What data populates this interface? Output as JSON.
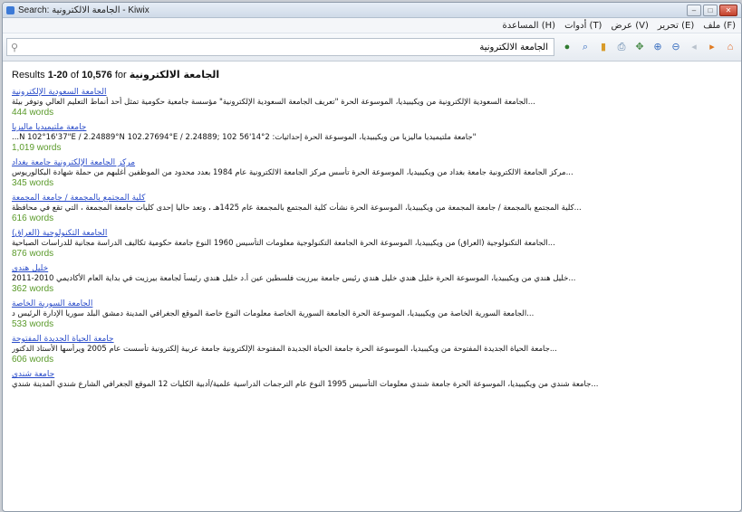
{
  "window": {
    "title": "Search: الجامعة الالكترونية - Kiwix"
  },
  "menu": [
    "المساعدة (H)",
    "أدوات (T)",
    "عرض (V)",
    "تحرير (E)",
    "ملف (F)"
  ],
  "search": {
    "value": "الجامعة الالكترونية",
    "placeholder": ""
  },
  "results": {
    "prefix": "Results",
    "range": "1-20",
    "of": "of",
    "total": "10,576",
    "for": "for",
    "query": "الجامعة الالكترونية"
  },
  "items": [
    {
      "title": "الجامعة السعودية الإلكترونية",
      "snippet": "...الجامعة السعودية الإلكترونية من ويكيبيديا، الموسوعة الحرة \"تعريف الجامعة السعودية الإلكترونية\" مؤسسة جامعية حكومية تمثل أحد أنماط التعليم العالي وتوفر بيئة",
      "words": "444 words"
    },
    {
      "title": "جامعة ملتيميديا ماليزيا",
      "snippet": "...N 102°16'37\"E / 2.24889°N 102.27694°E / 2.24889; 102 جامعة ملتيميديا ماليزيا من ويكيبيديا، الموسوعة الحرة إحداثيات: 2°14'56\"",
      "words": "1,019 words"
    },
    {
      "title": "مركز الجامعة الإلكترونية جامعة بغداد",
      "snippet": "...مركز الجامعة الالكترونية جامعة بغداد من ويكيبيديا، الموسوعة الحرة تأسس مركز الجامعة الالكترونية عام 1984 بعدد محدود من الموظفين أغلبهم من حملة شهادة البكالوريوس",
      "words": "345 words"
    },
    {
      "title": "كلية المجتمع بالمجمعة / جامعة المجمعة",
      "snippet": "...كلية المجتمع بالمجمعة / جامعة المجمعة من ويكيبيديا، الموسوعة الحرة نشأت كلية المجتمع بالمجمعة عام 1425هـ ، وتعد حاليا إحدى كليات جامعة المجمعة ، التي تقع في محافظة",
      "words": "616 words"
    },
    {
      "title": "الجامعة التكنولوجية (العراق)",
      "snippet": "...الجامعة التكنولوجية (العراق) من ويكيبيديا، الموسوعة الحرة الجامعة التكنولوجية معلومات التأسيس 1960 النوع جامعة حكومية تكاليف الدراسة مجانية للدراسات الصباحية",
      "words": "876 words"
    },
    {
      "title": "خليل هندي",
      "snippet": "...خليل هندي من ويكيبيديا، الموسوعة الحرة خليل هندي خليل هندي رئيس جامعة بيرزيت فلسطين عين أ.د خليل هندي رئيساً لجامعة بيرزيت في بداية العام الأكاديمي 2010-2011",
      "words": "362 words"
    },
    {
      "title": "الجامعة السورية الخاصة",
      "snippet": "...الجامعة السورية الخاصة من ويكيبيديا، الموسوعة الحرة الجامعة السورية الخاصة معلومات النوع خاصة الموقع الجغرافي المدينة دمشق البلد سوريا الإدارة الرئيس د",
      "words": "533 words"
    },
    {
      "title": "جامعة الحياة الجديدة المفتوحة",
      "snippet": "...جامعة الحياة الجديدة المفتوحة من ويكيبيديا، الموسوعة الحرة جامعة الحياة الجديدة المفتوحة الإلكترونية جامعة عربية إلكترونية تأسست عام 2005 ويرأسها الأستاذ الدكتور",
      "words": "606 words"
    },
    {
      "title": "جامعة شندي",
      "snippet": "...جامعة شندي من ويكيبيديا، الموسوعة الحرة جامعة شندي معلومات التأسيس 1995 النوع عام الترجمات الدراسية علمية/أدبية الكليات 12 الموقع الجغرافي الشارع شندي المدينة شندي",
      "words": ""
    }
  ]
}
